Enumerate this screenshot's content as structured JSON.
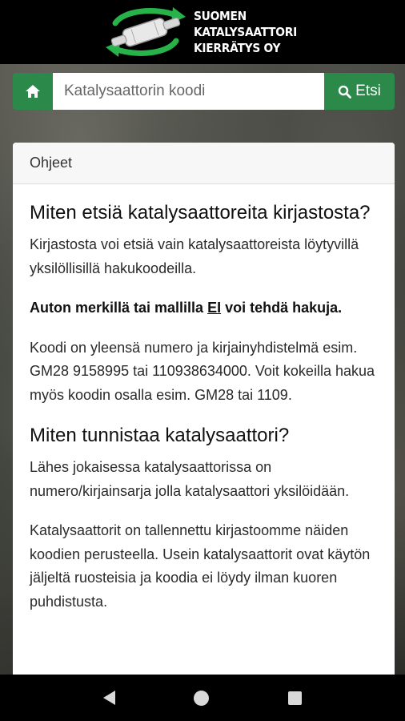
{
  "header": {
    "logo_lines": [
      "SUOMEN",
      "KATALYSAATTORI",
      "KIERRÄTYS OY"
    ]
  },
  "search": {
    "placeholder": "Katalysaattorin koodi",
    "button_label": "Etsi"
  },
  "card": {
    "header": "Ohjeet",
    "section1_title": "Miten etsiä katalysaattoreita kirjastosta?",
    "p1": "Kirjastosta voi etsiä vain katalysaattoreista löytyvillä yksilöllisillä hakukoodeilla.",
    "p2_before": "Auton merkillä tai mallilla ",
    "p2_em": "EI",
    "p2_after": " voi tehdä hakuja.",
    "p3": "Koodi on yleensä numero ja kirjainyhdistelmä esim. GM28 9158995 tai 110938634000. Voit kokeilla hakua myös koodin osalla esim. GM28 tai 1109.",
    "section2_title": "Miten tunnistaa katalysaattori?",
    "p4": "Lähes jokaisessa katalysaattorissa on numero/kirjainsarja jolla katalysaattori yksilöidään.",
    "p5": "Katalysaattorit on tallennettu kirjastoomme näiden koodien perusteella. Usein katalysaattorit ovat käytön jäljeltä ruosteisia ja koodia ei löydy ilman kuoren puhdistusta."
  },
  "colors": {
    "accent": "#2b8a4a",
    "header_bg": "#000000"
  }
}
